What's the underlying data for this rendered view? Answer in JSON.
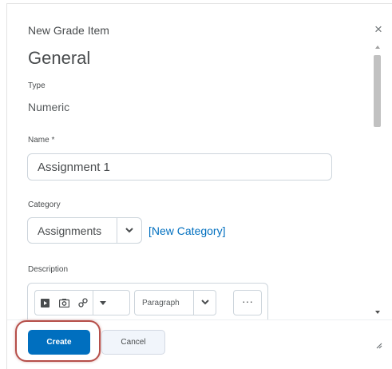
{
  "dialog": {
    "title": "New Grade Item",
    "close_label": "×"
  },
  "form": {
    "section_title": "General",
    "type_label": "Type",
    "type_value": "Numeric",
    "name_label": "Name *",
    "name_value": "Assignment 1",
    "category_label": "Category",
    "category_value": "Assignments",
    "new_category_link": "[New Category]",
    "description_label": "Description",
    "editor": {
      "format_value": "Paragraph",
      "more_label": "···"
    }
  },
  "footer": {
    "create_label": "Create",
    "cancel_label": "Cancel"
  },
  "colors": {
    "primary": "#006fbf",
    "link": "#006fbf",
    "highlight": "#b64f4a"
  },
  "icons": {
    "close": "close-icon",
    "video": "video-icon",
    "image": "image-icon",
    "link": "link-icon",
    "dropdown": "chevron-down-icon",
    "more": "more-icon",
    "resize": "resize-icon"
  }
}
